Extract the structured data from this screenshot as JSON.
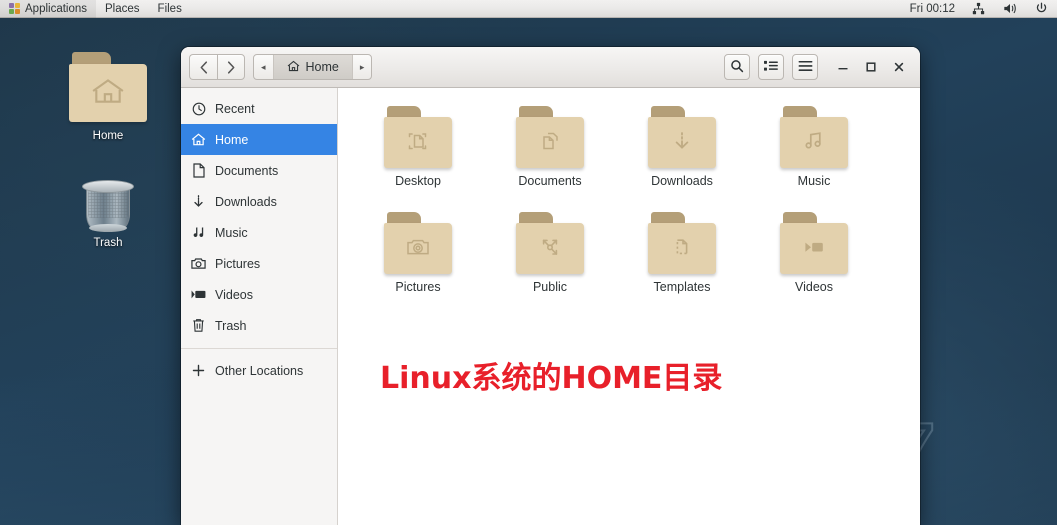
{
  "topbar": {
    "apps_label": "Applications",
    "places_label": "Places",
    "files_label": "Files",
    "clock": "Fri 00:12",
    "network_icon": "network-icon",
    "volume_icon": "volume-icon",
    "power_icon": "power-icon",
    "apps_icon": "pinwheel-icon"
  },
  "desktop": {
    "icons": [
      {
        "label": "Home",
        "icon": "home-folder-icon"
      },
      {
        "label": "Trash",
        "icon": "trash-can-icon"
      }
    ],
    "wallpaper_glyph": "7",
    "background_color": "#1e3a4f"
  },
  "window": {
    "title": "Files",
    "back_label": "‹",
    "forward_label": "›",
    "path_prev_label": "◂",
    "path_next_label": "▸",
    "breadcrumb": "Home",
    "search_label": "search-icon",
    "list_view_label": "list-view-icon",
    "menu_label": "hamburger-menu-icon",
    "minimize_label": "–",
    "maximize_label": "□",
    "close_label": "×",
    "accent_color": "#3584e4"
  },
  "sidebar": {
    "items": [
      {
        "label": "Recent",
        "icon": "clock-icon",
        "active": false
      },
      {
        "label": "Home",
        "icon": "home-icon",
        "active": true
      },
      {
        "label": "Documents",
        "icon": "document-icon",
        "active": false
      },
      {
        "label": "Downloads",
        "icon": "download-icon",
        "active": false
      },
      {
        "label": "Music",
        "icon": "music-icon",
        "active": false
      },
      {
        "label": "Pictures",
        "icon": "camera-icon",
        "active": false
      },
      {
        "label": "Videos",
        "icon": "video-icon",
        "active": false
      },
      {
        "label": "Trash",
        "icon": "trash-icon",
        "active": false
      }
    ],
    "other_locations": {
      "label": "Other Locations",
      "icon": "plus-icon"
    }
  },
  "files": [
    {
      "label": "Desktop",
      "icon": "folder-desktop-icon"
    },
    {
      "label": "Documents",
      "icon": "folder-documents-icon"
    },
    {
      "label": "Downloads",
      "icon": "folder-downloads-icon"
    },
    {
      "label": "Music",
      "icon": "folder-music-icon"
    },
    {
      "label": "Pictures",
      "icon": "folder-pictures-icon"
    },
    {
      "label": "Public",
      "icon": "folder-public-icon"
    },
    {
      "label": "Templates",
      "icon": "folder-templates-icon"
    },
    {
      "label": "Videos",
      "icon": "folder-videos-icon"
    }
  ],
  "annotation": {
    "text": "Linux系统的HOME目录",
    "color": "#e8202a"
  }
}
